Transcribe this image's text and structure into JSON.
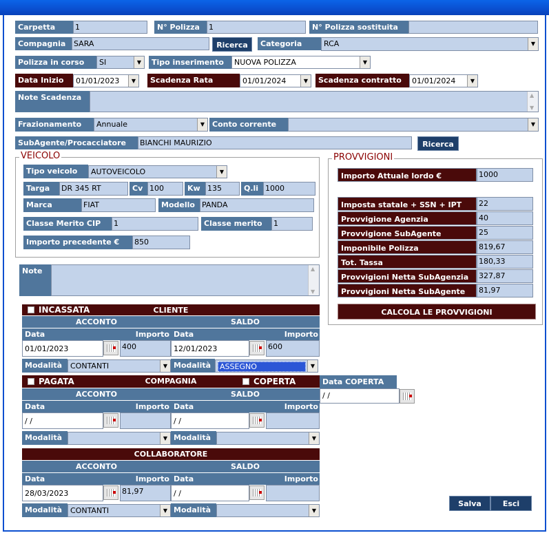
{
  "row1": {
    "carpetta_label": "Carpetta",
    "carpetta_value": "1",
    "polizza_label": "N° Polizza",
    "polizza_value": "1",
    "sostituita_label": "N° Polizza sostituita",
    "sostituita_value": ""
  },
  "row2": {
    "compagnia_label": "Compagnia",
    "compagnia_value": "SARA",
    "ricerca_label": "Ricerca",
    "categoria_label": "Categoria",
    "categoria_value": "RCA"
  },
  "row3": {
    "polizza_corso_label": "Polizza in corso",
    "polizza_corso_value": "SI",
    "tipo_ins_label": "Tipo inserimento",
    "tipo_ins_value": "NUOVA POLIZZA"
  },
  "row4": {
    "data_inizio_label": "Data Inizio",
    "data_inizio_value": "01/01/2023",
    "scad_rata_label": "Scadenza Rata",
    "scad_rata_value": "01/01/2024",
    "scad_contr_label": "Scadenza contratto",
    "scad_contr_value": "01/01/2024"
  },
  "row5": {
    "note_scad_label": "Note Scadenza",
    "note_scad_value": ""
  },
  "row6": {
    "fraz_label": "Frazionamento",
    "fraz_value": "Annuale",
    "conto_label": "Conto corrente",
    "conto_value": ""
  },
  "row7": {
    "subagente_label": "SubAgente/Procacciatore",
    "subagente_value": "BIANCHI MAURIZIO",
    "ricerca_label": "Ricerca"
  },
  "veicolo": {
    "title": "VEICOLO",
    "tipo_label": "Tipo veicolo",
    "tipo_value": "AUTOVEICOLO",
    "targa_label": "Targa",
    "targa_value": "DR 345 RT",
    "cv_label": "Cv",
    "cv_value": "100",
    "kw_label": "Kw",
    "kw_value": "135",
    "qli_label": "Q.li",
    "qli_value": "1000",
    "marca_label": "Marca",
    "marca_value": "FIAT",
    "modello_label": "Modello",
    "modello_value": "PANDA",
    "cip_label": "Classe Merito CIP",
    "cip_value": "1",
    "classe_label": "Classe merito",
    "classe_value": "1",
    "imp_prec_label": "Importo precedente €",
    "imp_prec_value": "850"
  },
  "provvigioni": {
    "title": "PROVVIGIONI",
    "rows": [
      {
        "label": "Importo Attuale lordo €",
        "value": "1000"
      },
      {
        "label": "Imposta statale + SSN + IPT",
        "value": "22"
      },
      {
        "label": "Provvigione Agenzia",
        "value": "40"
      },
      {
        "label": "Provvigione SubAgente",
        "value": "25"
      },
      {
        "label": "Imponibile Polizza",
        "value": "819,67"
      },
      {
        "label": "Tot. Tassa",
        "value": "180,33"
      },
      {
        "label": "Provvigioni Netta SubAgenzia",
        "value": "327,87"
      },
      {
        "label": "Provvigioni Netta SubAgente",
        "value": "81,97"
      }
    ],
    "calcola_label": "CALCOLA LE PROVVIGIONI"
  },
  "note": {
    "label": "Note",
    "value": ""
  },
  "cliente": {
    "check_label": "INCASSATA",
    "title": "CLIENTE",
    "acconto": "ACCONTO",
    "saldo": "SALDO",
    "data_label": "Data",
    "importo_label": "Importo",
    "acc_data": "01/01/2023",
    "acc_importo": "400",
    "sal_data": "12/01/2023",
    "sal_importo": "600",
    "modalita_label": "Modalità",
    "acc_modalita": "CONTANTI",
    "sal_modalita": "ASSEGNO"
  },
  "compagnia": {
    "check_label": "PAGATA",
    "title": "COMPAGNIA",
    "coperta_label": "COPERTA",
    "data_coperta_label": "Data COPERTA",
    "data_coperta_value": " /  /",
    "acconto": "ACCONTO",
    "saldo": "SALDO",
    "data_label": "Data",
    "importo_label": "Importo",
    "acc_data": " /  /",
    "acc_importo": "",
    "sal_data": " /  /",
    "sal_importo": "",
    "modalita_label": "Modalità",
    "acc_modalita": "",
    "sal_modalita": ""
  },
  "collaboratore": {
    "title": "COLLABORATORE",
    "acconto": "ACCONTO",
    "saldo": "SALDO",
    "data_label": "Data",
    "importo_label": "Importo",
    "acc_data": "28/03/2023",
    "acc_importo": "81,97",
    "sal_data": " /  /",
    "sal_importo": "",
    "modalita_label": "Modalità",
    "acc_modalita": "CONTANTI",
    "sal_modalita": ""
  },
  "buttons": {
    "salva": "Salva",
    "esci": "Esci"
  },
  "icons": {
    "dropdown": "▼"
  }
}
